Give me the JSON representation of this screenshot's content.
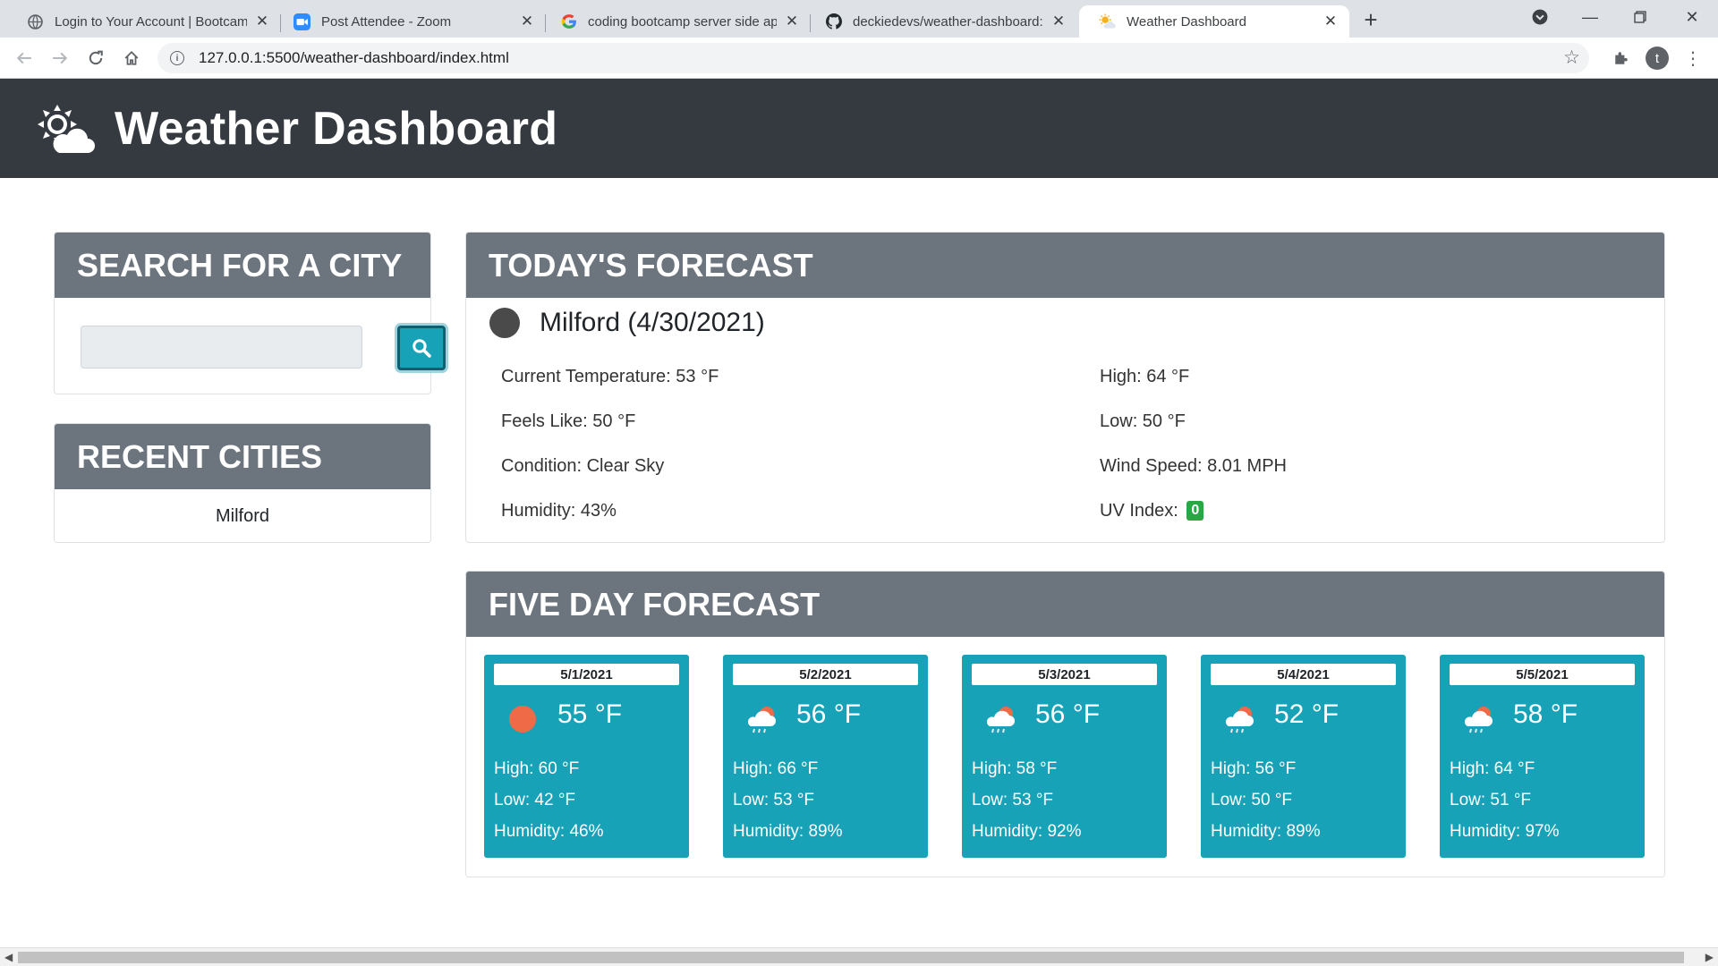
{
  "browser": {
    "tabs": [
      {
        "title": "Login to Your Account | Bootcamp",
        "icon": "globe-icon"
      },
      {
        "title": "Post Attendee - Zoom",
        "icon": "zoom-icon"
      },
      {
        "title": "coding bootcamp server side api",
        "icon": "google-icon"
      },
      {
        "title": "deckiedevs/weather-dashboard: ",
        "icon": "github-icon"
      },
      {
        "title": "Weather Dashboard",
        "icon": "sun-cloud-icon"
      }
    ],
    "active_tab_index": 4,
    "url": "127.0.0.1:5500/weather-dashboard/index.html",
    "profile_initial": "t"
  },
  "header": {
    "title": "Weather Dashboard"
  },
  "search": {
    "heading": "SEARCH FOR A CITY",
    "placeholder": "",
    "value": ""
  },
  "recent": {
    "heading": "RECENT CITIES",
    "cities": [
      "Milford"
    ]
  },
  "today": {
    "heading": "TODAY'S FORECAST",
    "city_line": "Milford (4/30/2021)",
    "current_temp": "Current Temperature: 53 °F",
    "feels_like": "Feels Like: 50 °F",
    "condition": "Condition: Clear Sky",
    "humidity": "Humidity: 43%",
    "high": "High: 64 °F",
    "low": "Low: 50 °F",
    "wind": "Wind Speed: 8.01 MPH",
    "uv_label": "UV Index:",
    "uv_value": "0"
  },
  "five_day": {
    "heading": "FIVE DAY FORECAST",
    "days": [
      {
        "date": "5/1/2021",
        "temp": "55 °F",
        "high": "High: 60 °F",
        "low": "Low: 42 °F",
        "humidity": "Humidity: 46%",
        "icon": "sun-icon"
      },
      {
        "date": "5/2/2021",
        "temp": "56 °F",
        "high": "High: 66 °F",
        "low": "Low: 53 °F",
        "humidity": "Humidity: 89%",
        "icon": "rain-icon"
      },
      {
        "date": "5/3/2021",
        "temp": "56 °F",
        "high": "High: 58 °F",
        "low": "Low: 53 °F",
        "humidity": "Humidity: 92%",
        "icon": "rain-icon"
      },
      {
        "date": "5/4/2021",
        "temp": "52 °F",
        "high": "High: 56 °F",
        "low": "Low: 50 °F",
        "humidity": "Humidity: 89%",
        "icon": "rain-icon"
      },
      {
        "date": "5/5/2021",
        "temp": "58 °F",
        "high": "High: 64 °F",
        "low": "Low: 51 °F",
        "humidity": "Humidity: 97%",
        "icon": "rain-icon"
      }
    ]
  },
  "colors": {
    "header_bg": "#343a40",
    "card_head_bg": "#6c757d",
    "forecast_card_bg": "#17a2b8",
    "uv_badge": "#28a745"
  }
}
